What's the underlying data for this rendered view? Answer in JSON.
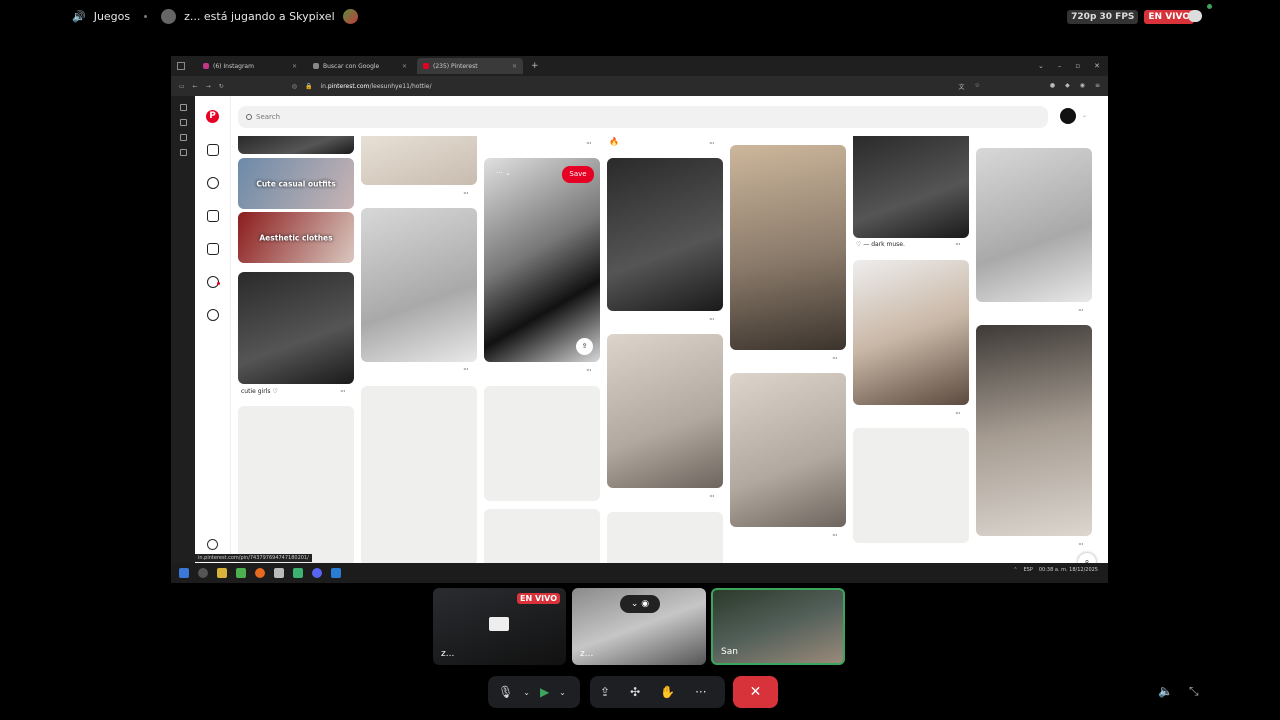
{
  "topbar": {
    "section": "Juegos",
    "activity": "z... está jugando a Skypixel",
    "quality": "720p 30 FPS",
    "live": "EN VIVO"
  },
  "browser": {
    "tabs": [
      {
        "label": "(6) Instagram",
        "color": "#c13584"
      },
      {
        "label": "Buscar con Google",
        "color": "#888888"
      },
      {
        "label": "(235) Pinterest",
        "color": "#e60023"
      }
    ],
    "url_prefix": "in.",
    "url_domain": "pinterest.com",
    "url_path": "/leesunhye11/hottie/",
    "status_url": "in.pinterest.com/pin/743797694747180201/"
  },
  "pinterest": {
    "logo": "P",
    "search_placeholder": "Search",
    "save_label": "Save",
    "board_cards": [
      "Cute casual outfits",
      "Aesthetic clothes"
    ],
    "captions": [
      "cutie girls ♡",
      "♡ — dark muse."
    ],
    "more": "···",
    "share": "⇪",
    "zoom": "⌕",
    "pin_menu": "··· ⌄"
  },
  "taskbar": {
    "time": "00:38 a. m.",
    "date": "18/12/2025",
    "lang": "ESP"
  },
  "call": {
    "tiles": [
      {
        "name": "z...",
        "live": "EN VIVO"
      },
      {
        "name": "z..."
      },
      {
        "name": "San"
      }
    ]
  },
  "controls": {
    "mic": "🎙",
    "camera": "▶",
    "screenshare": "⇪",
    "activities": "✣",
    "effects": "✋",
    "more": "···",
    "hangup": "✕"
  }
}
